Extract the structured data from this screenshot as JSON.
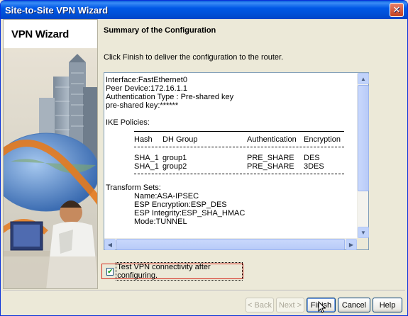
{
  "window": {
    "title": "Site-to-Site VPN Wizard",
    "close_glyph": "✕"
  },
  "side_panel": {
    "title": "VPN Wizard"
  },
  "content": {
    "section_title": "Summary of the Configuration",
    "instruction": "Click Finish to deliver the configuration to the router."
  },
  "summary": {
    "lines": [
      "Interface:FastEthernet0",
      "Peer Device:172.16.1.1",
      "Authentication Type : Pre-shared key",
      "pre-shared key:******",
      "",
      "IKE Policies:",
      "",
      "Transform Sets:",
      "Name:ASA-IPSEC",
      "ESP Encryption:ESP_DES",
      "ESP Integrity:ESP_SHA_HMAC",
      "Mode:TUNNEL"
    ],
    "ike_table": {
      "headers": [
        "Hash",
        "DH Group",
        "Authentication",
        "Encryption"
      ],
      "rows": [
        [
          "SHA_1",
          "group1",
          "PRE_SHARE",
          "DES"
        ],
        [
          "SHA_1",
          "group2",
          "PRE_SHARE",
          "3DES"
        ]
      ]
    }
  },
  "checkbox": {
    "label": "Test VPN connectivity after configuring.",
    "checked": true,
    "check_glyph": "✔"
  },
  "buttons": {
    "back": "< Back",
    "next": "Next >",
    "finish": "Finish",
    "cancel": "Cancel",
    "help": "Help"
  },
  "colors": {
    "titlebar": "#0058e6",
    "highlight_box": "#d52b1e"
  }
}
